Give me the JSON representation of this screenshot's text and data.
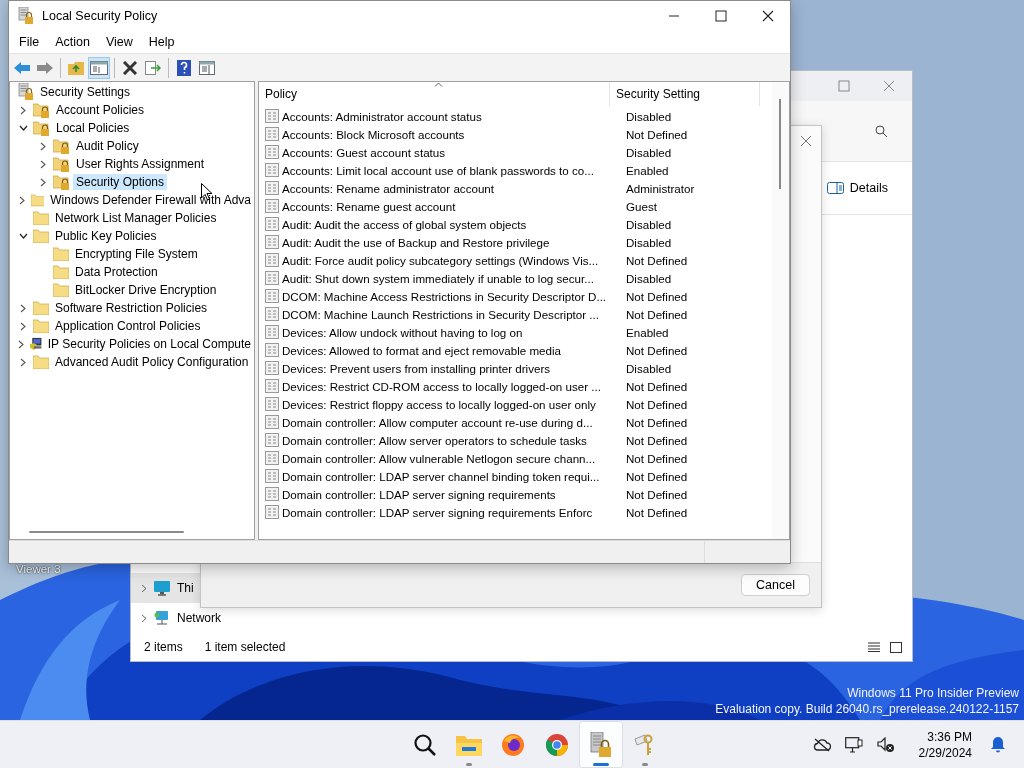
{
  "desktop": {
    "icon_label": "Viewer 3",
    "watermark": [
      "Windows 11 Pro Insider Preview",
      "Evaluation copy. Build 26040.rs_prerelease.240122-1157"
    ]
  },
  "explorer_window": {
    "details_button": "Details",
    "nav": [
      {
        "label": "Thi",
        "kind": "pc",
        "selected": true
      },
      {
        "label": "Network",
        "kind": "network",
        "selected": false
      }
    ],
    "status": [
      "2 items",
      "1 item selected"
    ]
  },
  "dialog": {
    "cancel_button": "Cancel"
  },
  "main_window": {
    "title": "Local Security Policy",
    "menu": [
      "File",
      "Action",
      "View",
      "Help"
    ],
    "toolbar": [
      [
        {
          "kind": "back",
          "selected": false
        },
        {
          "kind": "forward",
          "selected": false
        }
      ],
      [
        {
          "kind": "up",
          "selected": false
        },
        {
          "kind": "tree",
          "selected": true
        }
      ],
      [
        {
          "kind": "delete",
          "selected": false
        },
        {
          "kind": "export",
          "selected": false
        }
      ],
      [
        {
          "kind": "help",
          "selected": false
        },
        {
          "kind": "properties",
          "selected": false
        }
      ]
    ],
    "tree": [
      {
        "label": "Security Settings",
        "kind": "root",
        "selected": false,
        "children": [
          {
            "label": "Account Policies",
            "kind": "lock-folder",
            "expanded": false,
            "selected": false
          },
          {
            "label": "Local Policies",
            "kind": "lock-folder",
            "expanded": true,
            "selected": false,
            "children": [
              {
                "label": "Audit Policy",
                "kind": "lock-folder",
                "expanded": false,
                "selected": false
              },
              {
                "label": "User Rights Assignment",
                "kind": "lock-folder",
                "expanded": false,
                "selected": false
              },
              {
                "label": "Security Options",
                "kind": "lock-folder",
                "expanded": false,
                "selected": true
              }
            ]
          },
          {
            "label": "Windows Defender Firewall with Adva",
            "kind": "folder",
            "expanded": false,
            "selected": false
          },
          {
            "label": "Network List Manager Policies",
            "kind": "folder",
            "selected": false
          },
          {
            "label": "Public Key Policies",
            "kind": "folder",
            "expanded": true,
            "selected": false,
            "children": [
              {
                "label": "Encrypting File System",
                "kind": "folder",
                "selected": false
              },
              {
                "label": "Data Protection",
                "kind": "folder",
                "selected": false
              },
              {
                "label": "BitLocker Drive Encryption",
                "kind": "folder",
                "selected": false
              }
            ]
          },
          {
            "label": "Software Restriction Policies",
            "kind": "folder",
            "expanded": false,
            "selected": false
          },
          {
            "label": "Application Control Policies",
            "kind": "folder",
            "expanded": false,
            "selected": false
          },
          {
            "label": "IP Security Policies on Local Compute",
            "kind": "computer",
            "expanded": false,
            "selected": false
          },
          {
            "label": "Advanced Audit Policy Configuration",
            "kind": "folder",
            "expanded": false,
            "selected": false
          }
        ]
      }
    ],
    "columns": [
      {
        "label": "Policy",
        "sorted": true
      },
      {
        "label": "Security Setting",
        "sorted": false
      }
    ],
    "rows": [
      {
        "policy": "Accounts: Administrator account status",
        "setting": "Disabled"
      },
      {
        "policy": "Accounts: Block Microsoft accounts",
        "setting": "Not Defined"
      },
      {
        "policy": "Accounts: Guest account status",
        "setting": "Disabled"
      },
      {
        "policy": "Accounts: Limit local account use of blank passwords to co...",
        "setting": "Enabled"
      },
      {
        "policy": "Accounts: Rename administrator account",
        "setting": "Administrator"
      },
      {
        "policy": "Accounts: Rename guest account",
        "setting": "Guest"
      },
      {
        "policy": "Audit: Audit the access of global system objects",
        "setting": "Disabled"
      },
      {
        "policy": "Audit: Audit the use of Backup and Restore privilege",
        "setting": "Disabled"
      },
      {
        "policy": "Audit: Force audit policy subcategory settings (Windows Vis...",
        "setting": "Not Defined"
      },
      {
        "policy": "Audit: Shut down system immediately if unable to log secur...",
        "setting": "Disabled"
      },
      {
        "policy": "DCOM: Machine Access Restrictions in Security Descriptor D...",
        "setting": "Not Defined"
      },
      {
        "policy": "DCOM: Machine Launch Restrictions in Security Descriptor ...",
        "setting": "Not Defined"
      },
      {
        "policy": "Devices: Allow undock without having to log on",
        "setting": "Enabled"
      },
      {
        "policy": "Devices: Allowed to format and eject removable media",
        "setting": "Not Defined"
      },
      {
        "policy": "Devices: Prevent users from installing printer drivers",
        "setting": "Disabled"
      },
      {
        "policy": "Devices: Restrict CD-ROM access to locally logged-on user ...",
        "setting": "Not Defined"
      },
      {
        "policy": "Devices: Restrict floppy access to locally logged-on user only",
        "setting": "Not Defined"
      },
      {
        "policy": "Domain controller: Allow computer account re-use during d...",
        "setting": "Not Defined"
      },
      {
        "policy": "Domain controller: Allow server operators to schedule tasks",
        "setting": "Not Defined"
      },
      {
        "policy": "Domain controller: Allow vulnerable Netlogon secure chann...",
        "setting": "Not Defined"
      },
      {
        "policy": "Domain controller: LDAP server channel binding token requi...",
        "setting": "Not Defined"
      },
      {
        "policy": "Domain controller: LDAP server signing requirements",
        "setting": "Not Defined"
      },
      {
        "policy": "Domain controller: LDAP server signing requirements Enforc",
        "setting": "Not Defined"
      }
    ]
  },
  "taskbar": {
    "apps": [
      {
        "kind": "search",
        "running": false,
        "selected": false
      },
      {
        "kind": "files",
        "running": true,
        "selected": false
      },
      {
        "kind": "firefox",
        "running": false,
        "selected": false
      },
      {
        "kind": "chrome",
        "running": false,
        "selected": false
      },
      {
        "kind": "security",
        "running": true,
        "selected": true
      },
      {
        "kind": "keys",
        "running": true,
        "selected": false
      }
    ],
    "time": "3:36 PM",
    "date": "2/29/2024"
  }
}
